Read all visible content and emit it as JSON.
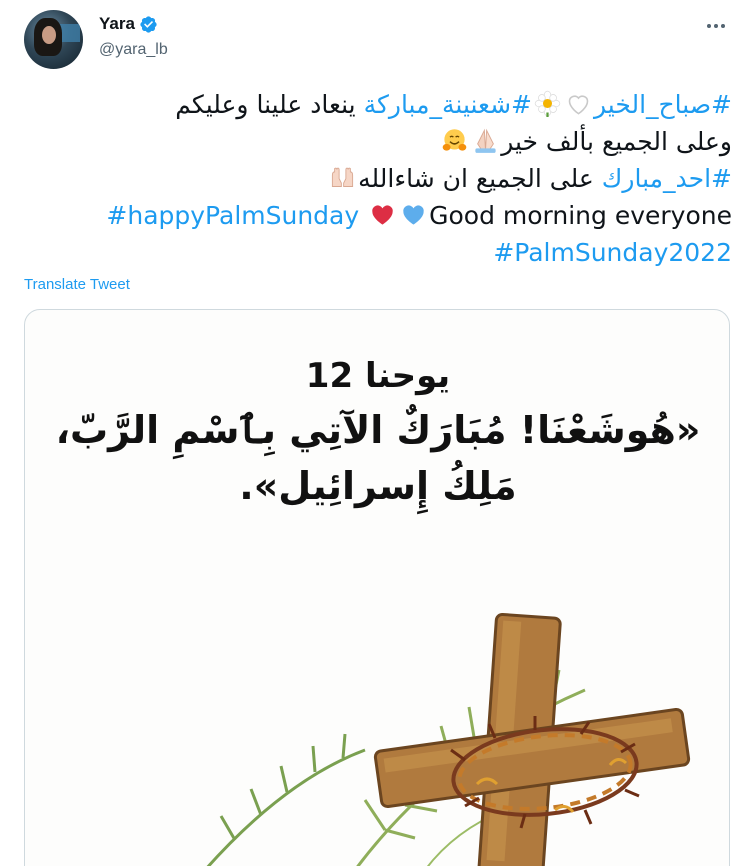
{
  "user": {
    "display_name": "Yara",
    "handle": "@yara_lb",
    "verified": true
  },
  "tweet": {
    "lines": [
      {
        "dir": "rtl",
        "parts": [
          {
            "type": "tag",
            "text": "#صباح_الخير"
          },
          {
            "type": "emoji",
            "name": "white-heart-emoji"
          },
          {
            "type": "emoji",
            "name": "daisy-emoji"
          },
          {
            "type": "tag",
            "text": "#شعنينة_مباركة"
          },
          {
            "type": "text",
            "text": " ينعاد علينا وعليكم"
          }
        ]
      },
      {
        "dir": "rtl",
        "parts": [
          {
            "type": "text",
            "text": "وعلى الجميع بألف خير"
          },
          {
            "type": "emoji",
            "name": "folded-hands-emoji"
          },
          {
            "type": "emoji",
            "name": "hugging-face-emoji"
          }
        ]
      },
      {
        "dir": "rtl",
        "parts": [
          {
            "type": "tag",
            "text": "#احد_مبارك"
          },
          {
            "type": "text",
            "text": " على الجميع ان شاءالله"
          },
          {
            "type": "emoji",
            "name": "raised-palms-emoji"
          }
        ]
      },
      {
        "dir": "ltr",
        "parts": [
          {
            "type": "tag",
            "text": "#happyPalmSunday"
          },
          {
            "type": "text",
            "text": " "
          },
          {
            "type": "emoji",
            "name": "red-heart-emoji"
          },
          {
            "type": "emoji",
            "name": "blue-heart-emoji"
          },
          {
            "type": "text",
            "text": "Good morning everyone"
          }
        ]
      },
      {
        "dir": "ltr",
        "parts": [
          {
            "type": "tag",
            "text": "#PalmSunday2022"
          }
        ]
      }
    ]
  },
  "translate_label": "Translate Tweet",
  "media": {
    "verse_reference": "يوحنا 12",
    "verse_lines": [
      "«هُوشَعْنَا! مُبَارَكٌ الآتِي بِٱسْمِ الرَّبّ،",
      "مَلِكُ إِسرائِيل»."
    ]
  },
  "colors": {
    "link": "#1d9bf0",
    "secondary_text": "#536471",
    "border": "#cfd9de"
  }
}
